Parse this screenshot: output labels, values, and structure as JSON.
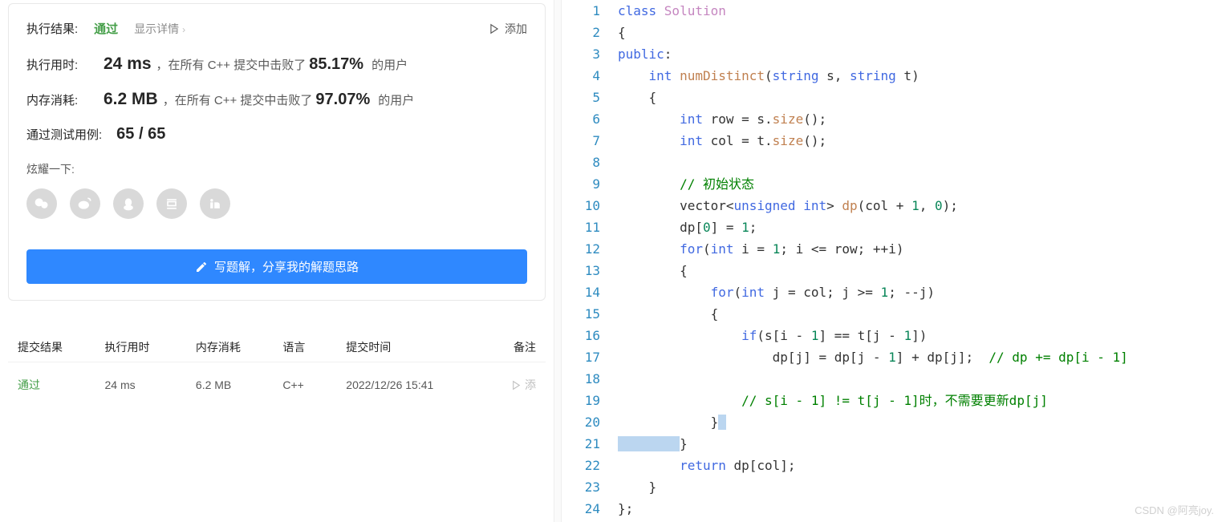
{
  "result": {
    "label": "执行结果:",
    "status": "通过",
    "detail_link": "显示详情",
    "add_note": "添加"
  },
  "stats": {
    "time_label": "执行用时:",
    "time_value": "24 ms",
    "time_text1": "，在所有 C++ 提交中击败了",
    "time_pct": "85.17%",
    "time_text2": "的用户",
    "mem_label": "内存消耗:",
    "mem_value": "6.2 MB",
    "mem_text1": "，在所有 C++ 提交中击败了",
    "mem_pct": "97.07%",
    "mem_text2": "的用户",
    "tests_label": "通过测试用例:",
    "tests_value": "65 / 65"
  },
  "share": {
    "label": "炫耀一下:"
  },
  "write_solution": "写题解，分享我的解题思路",
  "table": {
    "headers": {
      "result": "提交结果",
      "time": "执行用时",
      "memory": "内存消耗",
      "lang": "语言",
      "date": "提交时间",
      "note": "备注"
    },
    "row": {
      "result": "通过",
      "time": "24 ms",
      "memory": "6.2 MB",
      "lang": "C++",
      "date": "2022/12/26 15:41",
      "note": "添"
    }
  },
  "code": {
    "lines": [
      {
        "n": 1,
        "tokens": [
          {
            "t": "class ",
            "c": "kw"
          },
          {
            "t": "Solution",
            "c": "cls"
          }
        ]
      },
      {
        "n": 2,
        "tokens": [
          {
            "t": "{"
          }
        ]
      },
      {
        "n": 3,
        "tokens": [
          {
            "t": "public",
            "c": "kw"
          },
          {
            "t": ":"
          }
        ]
      },
      {
        "n": 4,
        "tokens": [
          {
            "t": "    "
          },
          {
            "t": "int ",
            "c": "type"
          },
          {
            "t": "numDistinct",
            "c": "fn"
          },
          {
            "t": "("
          },
          {
            "t": "string",
            "c": "type"
          },
          {
            "t": " s, "
          },
          {
            "t": "string",
            "c": "type"
          },
          {
            "t": " t)"
          }
        ]
      },
      {
        "n": 5,
        "tokens": [
          {
            "t": "    {"
          }
        ]
      },
      {
        "n": 6,
        "tokens": [
          {
            "t": "        "
          },
          {
            "t": "int",
            "c": "type"
          },
          {
            "t": " row = s."
          },
          {
            "t": "size",
            "c": "fn"
          },
          {
            "t": "();"
          }
        ]
      },
      {
        "n": 7,
        "tokens": [
          {
            "t": "        "
          },
          {
            "t": "int",
            "c": "type"
          },
          {
            "t": " col = t."
          },
          {
            "t": "size",
            "c": "fn"
          },
          {
            "t": "();"
          }
        ]
      },
      {
        "n": 8,
        "tokens": []
      },
      {
        "n": 9,
        "tokens": [
          {
            "t": "        "
          },
          {
            "t": "// 初始状态",
            "c": "cmt"
          }
        ]
      },
      {
        "n": 10,
        "tokens": [
          {
            "t": "        vector<"
          },
          {
            "t": "unsigned int",
            "c": "type"
          },
          {
            "t": "> "
          },
          {
            "t": "dp",
            "c": "fn"
          },
          {
            "t": "(col + "
          },
          {
            "t": "1",
            "c": "num"
          },
          {
            "t": ", "
          },
          {
            "t": "0",
            "c": "num"
          },
          {
            "t": ");"
          }
        ]
      },
      {
        "n": 11,
        "tokens": [
          {
            "t": "        dp["
          },
          {
            "t": "0",
            "c": "num"
          },
          {
            "t": "] = "
          },
          {
            "t": "1",
            "c": "num"
          },
          {
            "t": ";"
          }
        ]
      },
      {
        "n": 12,
        "tokens": [
          {
            "t": "        "
          },
          {
            "t": "for",
            "c": "kw"
          },
          {
            "t": "("
          },
          {
            "t": "int",
            "c": "type"
          },
          {
            "t": " i = "
          },
          {
            "t": "1",
            "c": "num"
          },
          {
            "t": "; i <= row; ++i)"
          }
        ]
      },
      {
        "n": 13,
        "tokens": [
          {
            "t": "        {"
          }
        ]
      },
      {
        "n": 14,
        "tokens": [
          {
            "t": "            "
          },
          {
            "t": "for",
            "c": "kw"
          },
          {
            "t": "("
          },
          {
            "t": "int",
            "c": "type"
          },
          {
            "t": " j = col; j >= "
          },
          {
            "t": "1",
            "c": "num"
          },
          {
            "t": "; --j)"
          }
        ]
      },
      {
        "n": 15,
        "tokens": [
          {
            "t": "            {"
          }
        ]
      },
      {
        "n": 16,
        "tokens": [
          {
            "t": "                "
          },
          {
            "t": "if",
            "c": "kw"
          },
          {
            "t": "(s[i - "
          },
          {
            "t": "1",
            "c": "num"
          },
          {
            "t": "] == t[j - "
          },
          {
            "t": "1",
            "c": "num"
          },
          {
            "t": "])"
          }
        ]
      },
      {
        "n": 17,
        "tokens": [
          {
            "t": "                    dp[j] = dp[j - "
          },
          {
            "t": "1",
            "c": "num"
          },
          {
            "t": "] + dp[j];  "
          },
          {
            "t": "// dp += dp[i - 1]",
            "c": "cmt"
          }
        ]
      },
      {
        "n": 18,
        "tokens": []
      },
      {
        "n": 19,
        "tokens": [
          {
            "t": "                "
          },
          {
            "t": "// s[i - 1] != t[j - 1]时，不需要更新dp[j]",
            "c": "cmt"
          }
        ]
      },
      {
        "n": 20,
        "tokens": [
          {
            "t": "            }"
          },
          {
            "t": " ",
            "c": "hl"
          }
        ]
      },
      {
        "n": 21,
        "tokens": [
          {
            "t": "        ",
            "c": "hl"
          },
          {
            "t": "}"
          }
        ]
      },
      {
        "n": 22,
        "tokens": [
          {
            "t": "        "
          },
          {
            "t": "return",
            "c": "kw"
          },
          {
            "t": " dp[col];"
          }
        ]
      },
      {
        "n": 23,
        "tokens": [
          {
            "t": "    }"
          }
        ]
      },
      {
        "n": 24,
        "tokens": [
          {
            "t": "};"
          }
        ]
      }
    ]
  },
  "watermark": "CSDN @阿亮joy."
}
